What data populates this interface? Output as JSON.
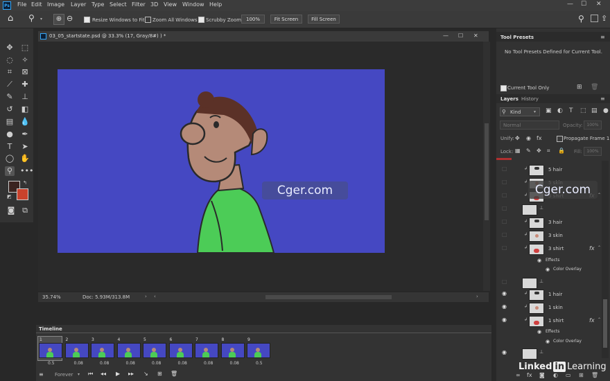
{
  "menubar": {
    "app_icon": "Ps",
    "items": [
      "File",
      "Edit",
      "Image",
      "Layer",
      "Type",
      "Select",
      "Filter",
      "3D",
      "View",
      "Window",
      "Help"
    ],
    "controls": {
      "minimize": "—",
      "maximize": "☐",
      "close": "✕"
    }
  },
  "options": {
    "resize_windows_label": "Resize Windows to Fit",
    "zoom_all_label": "Zoom All Windows",
    "scrubby_label": "Scrubby Zoom",
    "zoom_value": "100%",
    "fit_screen": "Fit Screen",
    "fill_screen": "Fill Screen"
  },
  "document": {
    "tab_title": "03_05_startstate.psd @ 33.3% (17, Gray/8#)   ) *",
    "zoom": "35.74%",
    "doc_size": "Doc: 5.93M/313.8M"
  },
  "watermark": "Cger.com",
  "timeline": {
    "title": "Timeline",
    "loop": "Forever",
    "frames": [
      {
        "num": "1",
        "delay": "0.5"
      },
      {
        "num": "2",
        "delay": "0.08"
      },
      {
        "num": "3",
        "delay": "0.08"
      },
      {
        "num": "4",
        "delay": "0.08"
      },
      {
        "num": "5",
        "delay": "0.08"
      },
      {
        "num": "6",
        "delay": "0.08"
      },
      {
        "num": "7",
        "delay": "0.08"
      },
      {
        "num": "8",
        "delay": "0.08"
      },
      {
        "num": "9",
        "delay": "0.5"
      }
    ]
  },
  "tool_presets": {
    "title": "Tool Presets",
    "message": "No Tool Presets Defined for Current Tool.",
    "current_tool_only": "Current Tool Only"
  },
  "layers": {
    "tab_layers": "Layers",
    "tab_history": "History",
    "kind": "Kind",
    "blend_mode": "Normal",
    "opacity_label": "Opacity:",
    "opacity_value": "100%",
    "unify_label": "Unify:",
    "propagate_label": "Propagate Frame 1",
    "lock_label": "Lock:",
    "fill_label": "Fill:",
    "fill_value": "100%",
    "rows": [
      {
        "name": "5 hair",
        "visible": false,
        "fx": false
      },
      {
        "name": "5 skin",
        "visible": false,
        "fx": false
      },
      {
        "name": "5 shirt",
        "visible": false,
        "fx": true
      },
      {
        "name": "",
        "visible": false,
        "fx": false
      },
      {
        "name": "3 hair",
        "visible": false,
        "fx": false
      },
      {
        "name": "3 skin",
        "visible": false,
        "fx": false
      },
      {
        "name": "3 shirt",
        "visible": false,
        "fx": true
      },
      {
        "name": "",
        "visible": false,
        "fx": false
      },
      {
        "name": "1 hair",
        "visible": true,
        "fx": false
      },
      {
        "name": "1 skin",
        "visible": true,
        "fx": false
      },
      {
        "name": "1 shirt",
        "visible": true,
        "fx": true
      },
      {
        "name": "",
        "visible": true,
        "fx": false
      }
    ],
    "effects_label": "Effects",
    "color_overlay_label": "Color Overlay"
  },
  "linkedin": {
    "prefix": "Linked",
    "badge": "in",
    "suffix": "Learning"
  }
}
